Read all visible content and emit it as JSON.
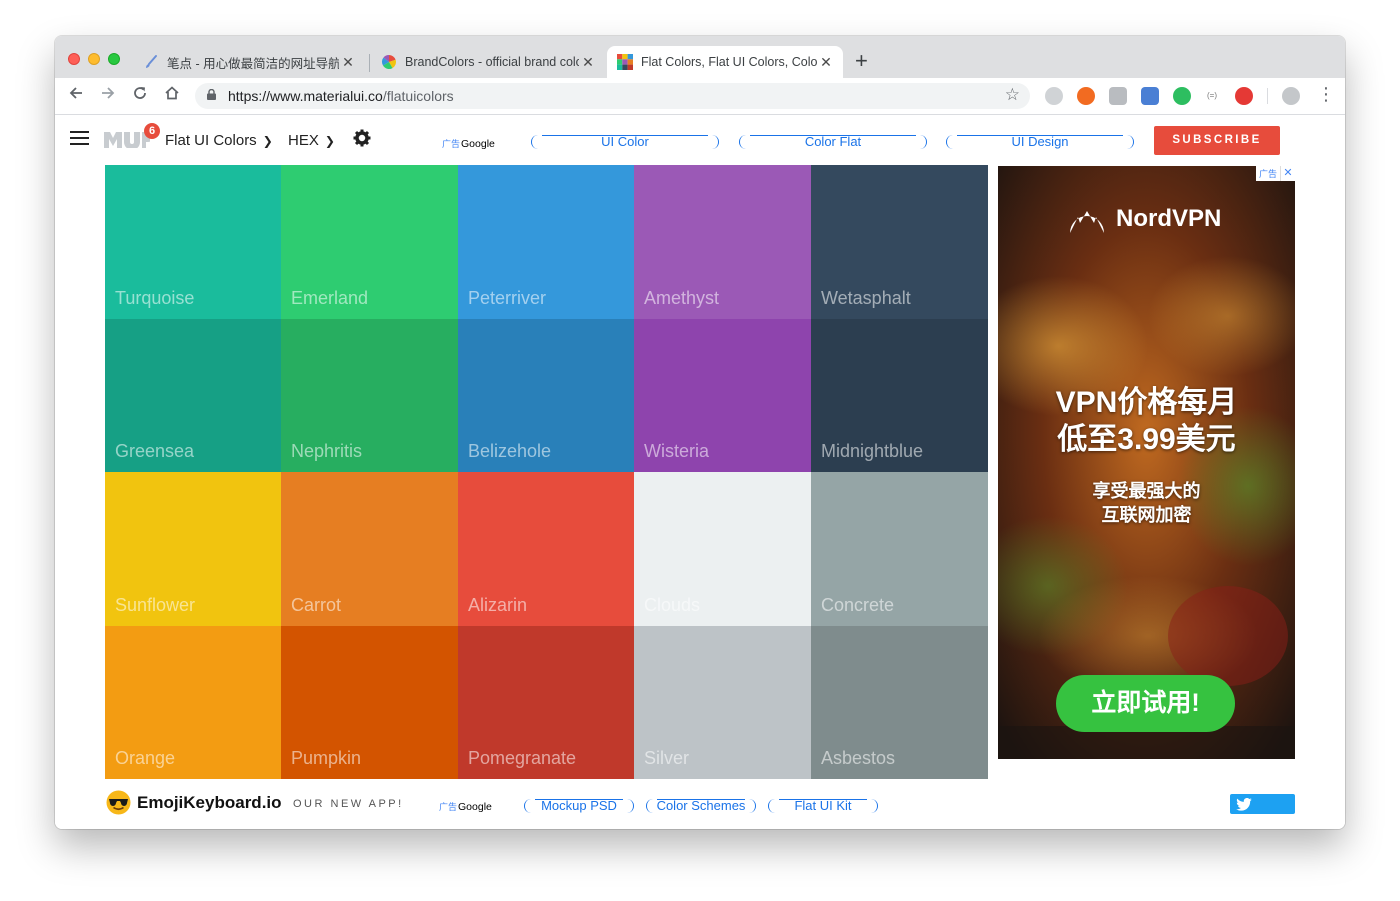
{
  "browser": {
    "tabs": [
      {
        "title": "笔点 - 用心做最简洁的网址导航",
        "close": "✕",
        "active": false
      },
      {
        "title": "BrandColors - official brand colors",
        "close": "✕",
        "active": false
      },
      {
        "title": "Flat Colors, Flat UI Colors, Color",
        "close": "✕",
        "active": true
      }
    ],
    "new_tab": "+",
    "url_host": "https://www.materialui.co",
    "url_path": "/flatuicolors",
    "bookmark_icon": "star-icon",
    "extension_badge": "(=)"
  },
  "header": {
    "notification_count": "6",
    "palette_dropdown": "Flat UI Colors",
    "format_dropdown": "HEX",
    "ad_label_cn": "广告",
    "ad_label": "Google",
    "ad_links": [
      "UI Color",
      "Color Flat",
      "UI Design"
    ],
    "subscribe_label": "SUBSCRIBE"
  },
  "colors": [
    {
      "name": "Turquoise",
      "hex": "#1abc9c"
    },
    {
      "name": "Emerland",
      "hex": "#2ecc71"
    },
    {
      "name": "Peterriver",
      "hex": "#3498db"
    },
    {
      "name": "Amethyst",
      "hex": "#9b59b6"
    },
    {
      "name": "Wetasphalt",
      "hex": "#34495e"
    },
    {
      "name": "Greensea",
      "hex": "#16a085"
    },
    {
      "name": "Nephritis",
      "hex": "#27ae60"
    },
    {
      "name": "Belizehole",
      "hex": "#2980b9"
    },
    {
      "name": "Wisteria",
      "hex": "#8e44ad"
    },
    {
      "name": "Midnightblue",
      "hex": "#2c3e50"
    },
    {
      "name": "Sunflower",
      "hex": "#f1c40f"
    },
    {
      "name": "Carrot",
      "hex": "#e67e22"
    },
    {
      "name": "Alizarin",
      "hex": "#e74c3c"
    },
    {
      "name": "Clouds",
      "hex": "#ecf0f1"
    },
    {
      "name": "Concrete",
      "hex": "#95a5a6"
    },
    {
      "name": "Orange",
      "hex": "#f39c12"
    },
    {
      "name": "Pumpkin",
      "hex": "#d35400"
    },
    {
      "name": "Pomegranate",
      "hex": "#c0392b"
    },
    {
      "name": "Silver",
      "hex": "#bdc3c7"
    },
    {
      "name": "Asbestos",
      "hex": "#7f8c8d"
    }
  ],
  "side_ad": {
    "corner_label": "广告",
    "close": "✕",
    "brand": "NordVPN",
    "headline_1": "VPN价格每月",
    "headline_2": "低至3.99美元",
    "sub_1": "享受最强大的",
    "sub_2": "互联网加密",
    "cta": "立即试用!"
  },
  "footer": {
    "app_name": "EmojiKeyboard.io",
    "tagline": "OUR NEW APP!",
    "ad_label_cn": "广告",
    "ad_label": "Google",
    "ad_links": [
      "Mockup PSD",
      "Color Schemes",
      "Flat UI Kit"
    ]
  }
}
